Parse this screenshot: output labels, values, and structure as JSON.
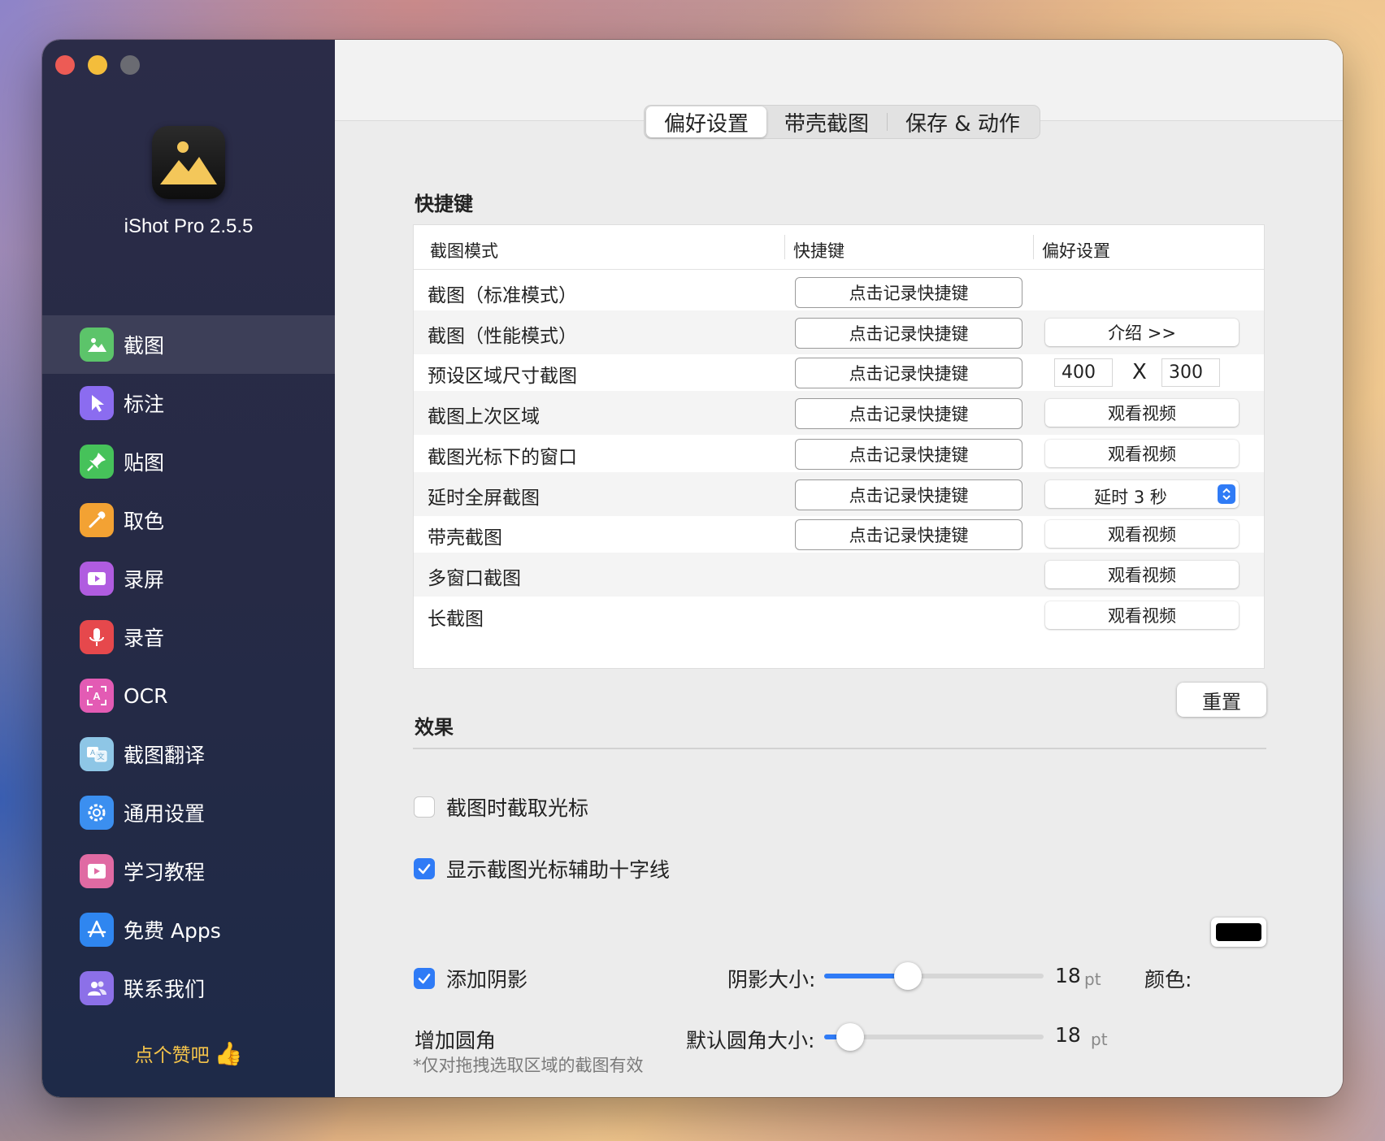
{
  "app": {
    "name": "iShot Pro 2.5.5"
  },
  "sidebar": {
    "items": [
      {
        "label": "截图",
        "icon": "image-icon",
        "color": "#5cc46a",
        "active": true
      },
      {
        "label": "标注",
        "icon": "pointer-icon",
        "color": "#8b6cf0"
      },
      {
        "label": "贴图",
        "icon": "pin-icon",
        "color": "#46c25a"
      },
      {
        "label": "取色",
        "icon": "eyedropper-icon",
        "color": "#f3a233"
      },
      {
        "label": "录屏",
        "icon": "video-icon",
        "color": "#b05ce0"
      },
      {
        "label": "录音",
        "icon": "mic-icon",
        "color": "#e6484c"
      },
      {
        "label": "OCR",
        "icon": "ocr-icon",
        "color": "#e35bb4"
      },
      {
        "label": "截图翻译",
        "icon": "translate-icon",
        "color": "#8ec6e6"
      },
      {
        "label": "通用设置",
        "icon": "gear-icon",
        "color": "#3b8ff0"
      },
      {
        "label": "学习教程",
        "icon": "tutorial-icon",
        "color": "#e06aa3"
      },
      {
        "label": "免费 Apps",
        "icon": "appstore-icon",
        "color": "#2f86f0"
      },
      {
        "label": "联系我们",
        "icon": "contacts-icon",
        "color": "#8c70e8"
      }
    ],
    "like_text": "点个赞吧",
    "like_emoji": "👍"
  },
  "tabs": [
    {
      "label": "偏好设置",
      "active": true
    },
    {
      "label": "带壳截图",
      "active": false
    },
    {
      "label": "保存 & 动作",
      "active": false
    }
  ],
  "shortcuts": {
    "title": "快捷键",
    "columns": [
      "截图模式",
      "快捷键",
      "偏好设置"
    ],
    "record_label": "点击记录快捷键",
    "rows": [
      {
        "mode": "截图（标准模式）",
        "record": true,
        "pref": null
      },
      {
        "mode": "截图（性能模式）",
        "record": true,
        "pref": "介绍 >>"
      },
      {
        "mode": "预设区域尺寸截图",
        "record": true,
        "pref_size": {
          "width": "400",
          "x": "X",
          "height": "300"
        }
      },
      {
        "mode": "截图上次区域",
        "record": true,
        "pref": "观看视频"
      },
      {
        "mode": "截图光标下的窗口",
        "record": true,
        "pref": "观看视频"
      },
      {
        "mode": "延时全屏截图",
        "record": true,
        "pref_select": "延时 3 秒"
      },
      {
        "mode": "带壳截图",
        "record": true,
        "pref": "观看视频"
      },
      {
        "mode": "多窗口截图",
        "record": false,
        "pref": "观看视频"
      },
      {
        "mode": "长截图",
        "record": false,
        "pref": "观看视频"
      }
    ],
    "reset_label": "重置"
  },
  "effects": {
    "title": "效果",
    "capture_cursor": {
      "label": "截图时截取光标",
      "checked": false
    },
    "crosshair": {
      "label": "显示截图光标辅助十字线",
      "checked": true
    },
    "shadow": {
      "label": "添加阴影",
      "checked": true,
      "size_label": "阴影大小:",
      "value": "18",
      "unit": "pt",
      "slider_fraction": 0.38,
      "color_label": "颜色:",
      "color": "#000000"
    },
    "corner": {
      "label": "增加圆角",
      "size_label": "默认圆角大小:",
      "value": "18",
      "unit": "pt",
      "slider_fraction": 0.12,
      "note": "*仅对拖拽选取区域的截图有效"
    }
  },
  "accent": "#2f7bf6"
}
